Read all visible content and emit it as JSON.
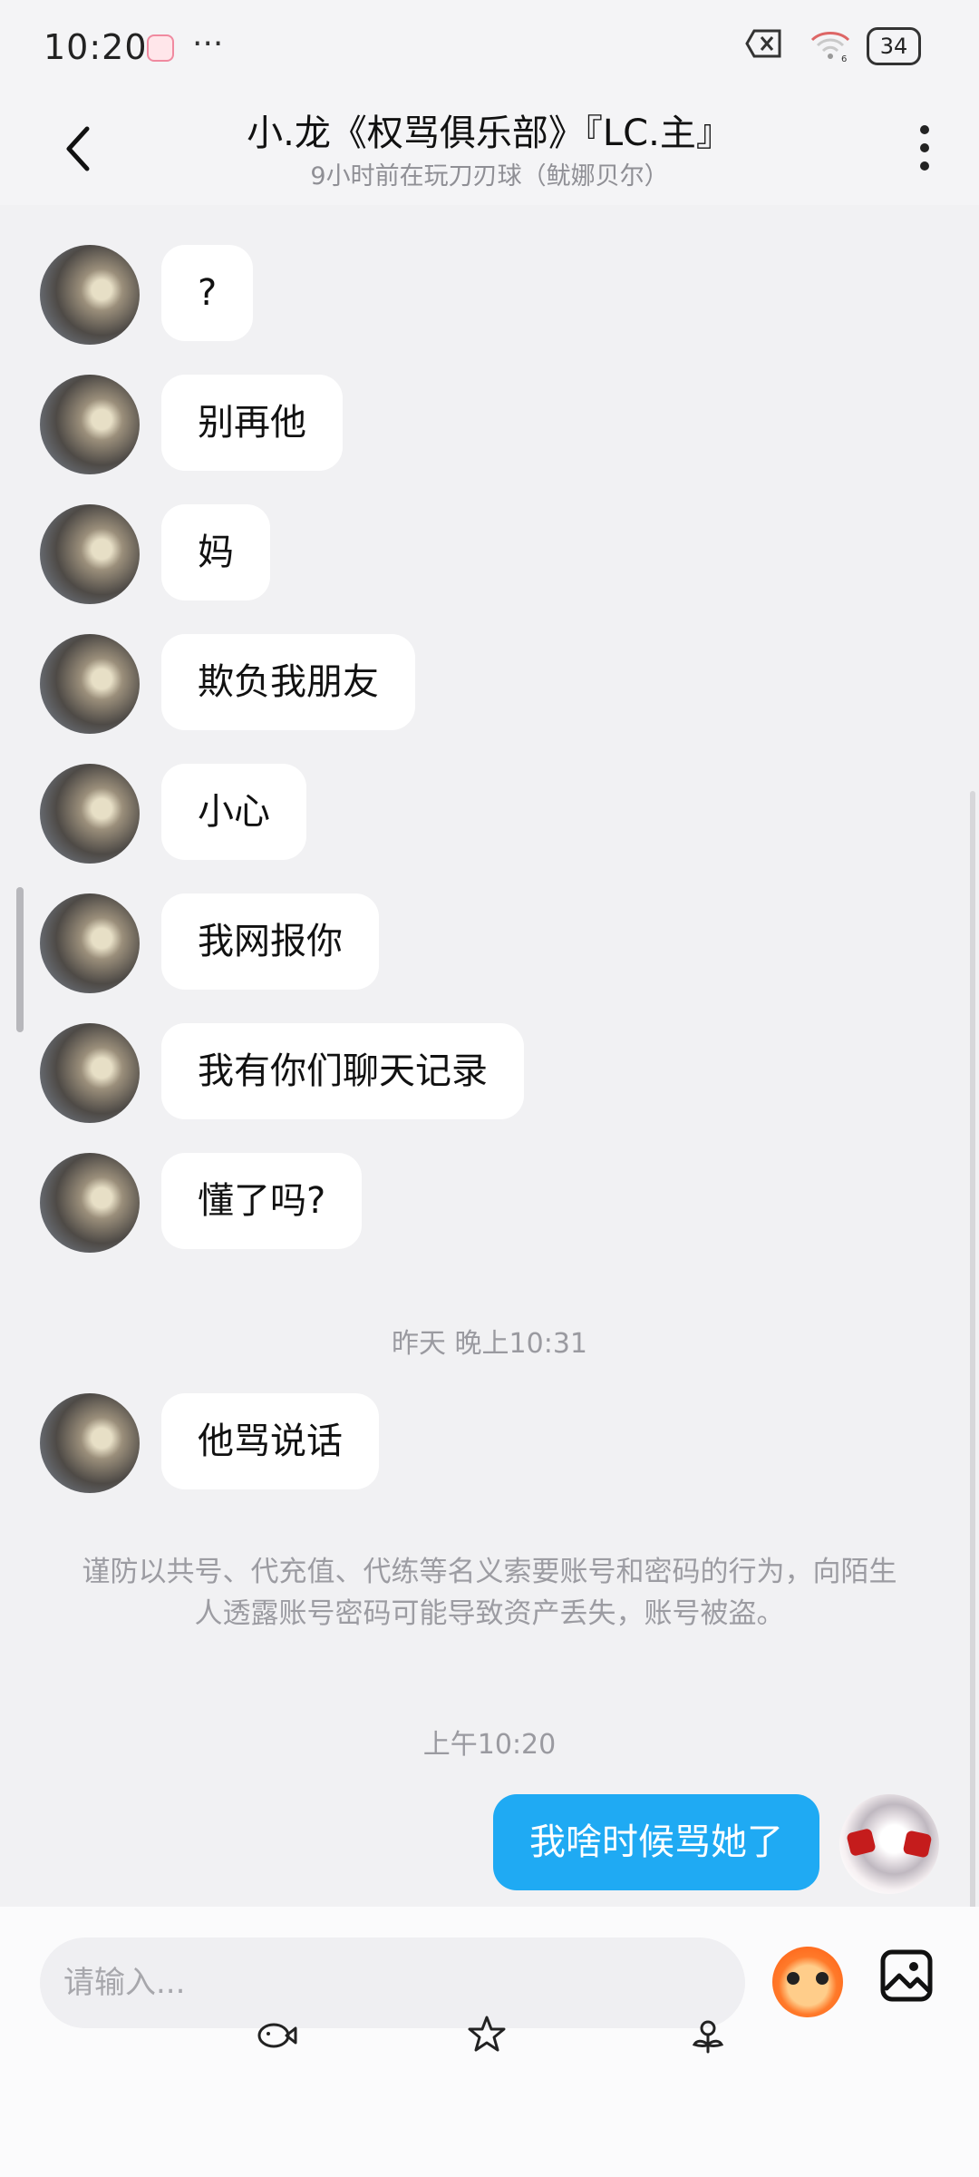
{
  "status": {
    "time": "10:20",
    "more": "···",
    "battery": "34",
    "wifi_sub": "6"
  },
  "header": {
    "title": "小.龙《权骂俱乐部》『LC.主』",
    "subtitle": "9小时前在玩刀刃球（鱿娜贝尔）"
  },
  "messages": [
    {
      "text": "?"
    },
    {
      "text": "别再他"
    },
    {
      "text": "妈"
    },
    {
      "text": "欺负我朋友"
    },
    {
      "text": "小心"
    },
    {
      "text": "我网报你"
    },
    {
      "text": "我有你们聊天记录"
    },
    {
      "text": "懂了吗?"
    }
  ],
  "time_yesterday": "昨天 晚上10:31",
  "message_after_yesterday": "他骂说话",
  "notice": "谨防以共号、代充值、代练等名义索要账号和密码的行为，向陌生人透露账号密码可能导致资产丢失，账号被盗。",
  "time_today": "上午10:20",
  "my_message": "我啥时候骂她了",
  "input": {
    "placeholder": "请输入..."
  },
  "icons": {
    "back": "back-arrow-icon",
    "more": "more-vertical-icon",
    "emoji": "emoji-icon",
    "image": "image-icon"
  }
}
